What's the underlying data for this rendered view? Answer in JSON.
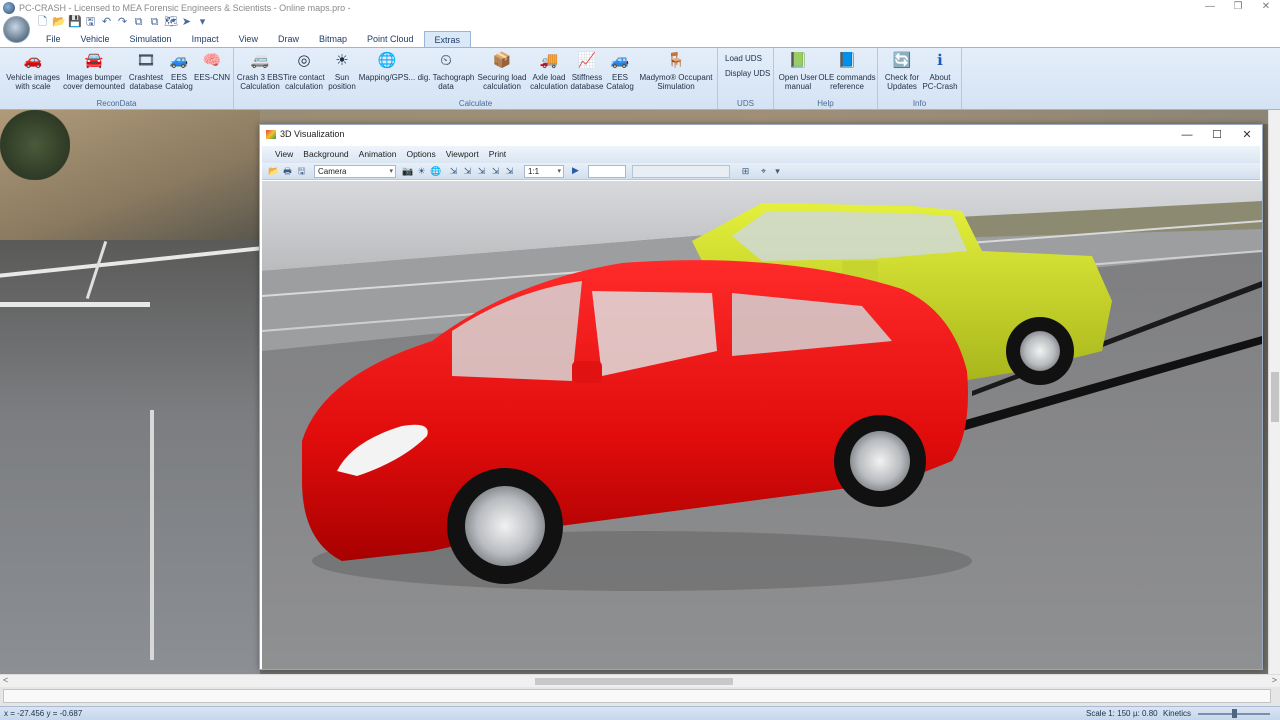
{
  "window": {
    "title": "PC-CRASH - Licensed to MEA Forensic Engineers & Scientists - Online maps.pro -",
    "minimize": "—",
    "restore": "❐",
    "close": "✕"
  },
  "quick_access": [
    "🗋",
    "📂",
    "💾",
    "🖫",
    "↶",
    "↷",
    "⧉",
    "⧉",
    "🗺",
    "➤",
    "▾"
  ],
  "ribbon_tabs": [
    "File",
    "Vehicle",
    "Simulation",
    "Impact",
    "View",
    "Draw",
    "Bitmap",
    "Point Cloud",
    "Extras"
  ],
  "active_tab": "Extras",
  "ribbon": {
    "recon": {
      "label": "ReconData",
      "buttons": [
        {
          "label1": "Vehicle images",
          "label2": "with scale",
          "icon": "🚗"
        },
        {
          "label1": "Images bumper",
          "label2": "cover demounted",
          "icon": "🚘"
        },
        {
          "label1": "Crashtest",
          "label2": "database",
          "icon": "🎞"
        },
        {
          "label1": "EES",
          "label2": "Catalog",
          "icon": "🚙"
        },
        {
          "label1": "EES-CNN",
          "label2": "",
          "icon": "🧠"
        }
      ]
    },
    "calculate": {
      "label": "Calculate",
      "buttons": [
        {
          "label1": "Crash 3 EBS",
          "label2": "Calculation",
          "icon": "🚐"
        },
        {
          "label1": "Tire contact",
          "label2": "calculation",
          "icon": "◎"
        },
        {
          "label1": "Sun",
          "label2": "position",
          "icon": "☀"
        },
        {
          "label1": "Mapping/GPS...",
          "label2": "",
          "icon": "🌐"
        },
        {
          "label1": "dig. Tachograph",
          "label2": "data",
          "icon": "⏲"
        },
        {
          "label1": "Securing load",
          "label2": "calculation",
          "icon": "📦"
        },
        {
          "label1": "Axle load",
          "label2": "calculation",
          "icon": "🚚"
        },
        {
          "label1": "Stiffness",
          "label2": "database",
          "icon": "📈"
        },
        {
          "label1": "EES",
          "label2": "Catalog",
          "icon": "🚙"
        },
        {
          "label1": "Madymo® Occupant",
          "label2": "Simulation",
          "icon": "🪑"
        }
      ]
    },
    "uds": {
      "label": "UDS",
      "load": "Load UDS",
      "display": "Display UDS"
    },
    "help": {
      "label": "Help",
      "buttons": [
        {
          "label1": "Open User",
          "label2": "manual",
          "icon": "📗"
        },
        {
          "label1": "OLE commands",
          "label2": "reference",
          "icon": "📘"
        }
      ]
    },
    "info": {
      "label": "Info",
      "buttons": [
        {
          "label1": "Check for",
          "label2": "Updates",
          "icon": "🔄"
        },
        {
          "label1": "About",
          "label2": "PC-Crash",
          "icon": "ℹ"
        }
      ]
    }
  },
  "viz": {
    "title": "3D Visualization",
    "menu": [
      "View",
      "Background",
      "Animation",
      "Options",
      "Viewport",
      "Print"
    ],
    "camera": "Camera",
    "ratio": "1:1",
    "tool_icons": [
      "📂",
      "🖶",
      "🖫",
      "📷",
      "☀",
      "🌐",
      "⇲",
      "⇲",
      "⇲",
      "⇲",
      "⇲",
      "▶",
      "⊞",
      "⌖",
      "▾"
    ]
  },
  "status": {
    "coords": "x = -27.456 y = -0.687",
    "scale": "Scale 1: 150",
    "mu": "µ: 0.80",
    "kinetics": "Kinetics"
  },
  "colors": {
    "red_car": "#e01414",
    "yellow_truck": "#c9d82a",
    "road": "#7e7e80",
    "accent": "#1f3d6b"
  }
}
